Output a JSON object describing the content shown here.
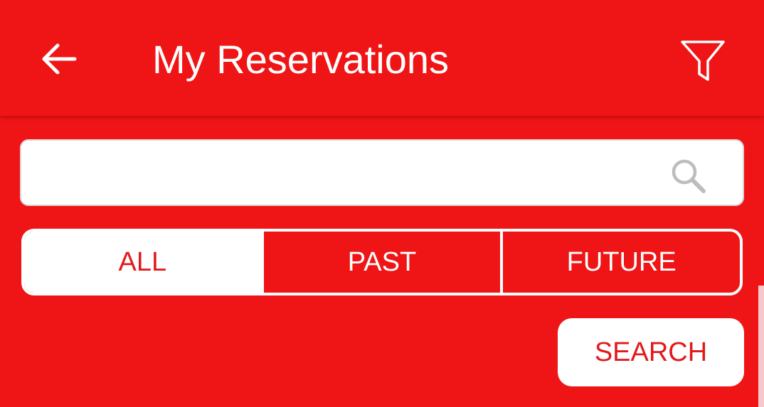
{
  "app_bar": {
    "title": "My Reservations",
    "back_icon": "arrow-left-icon",
    "filter_icon": "funnel-icon"
  },
  "search": {
    "value": "",
    "placeholder": "",
    "icon": "magnifier-icon"
  },
  "segments": [
    {
      "label": "ALL",
      "selected": true
    },
    {
      "label": "PAST",
      "selected": false
    },
    {
      "label": "FUTURE",
      "selected": false
    }
  ],
  "search_button": {
    "label": "SEARCH"
  },
  "colors": {
    "brand_red": "#EF1516",
    "accent_text_red": "#E21A1C",
    "white": "#FFFFFF",
    "icon_gray": "#BDBDBD"
  }
}
